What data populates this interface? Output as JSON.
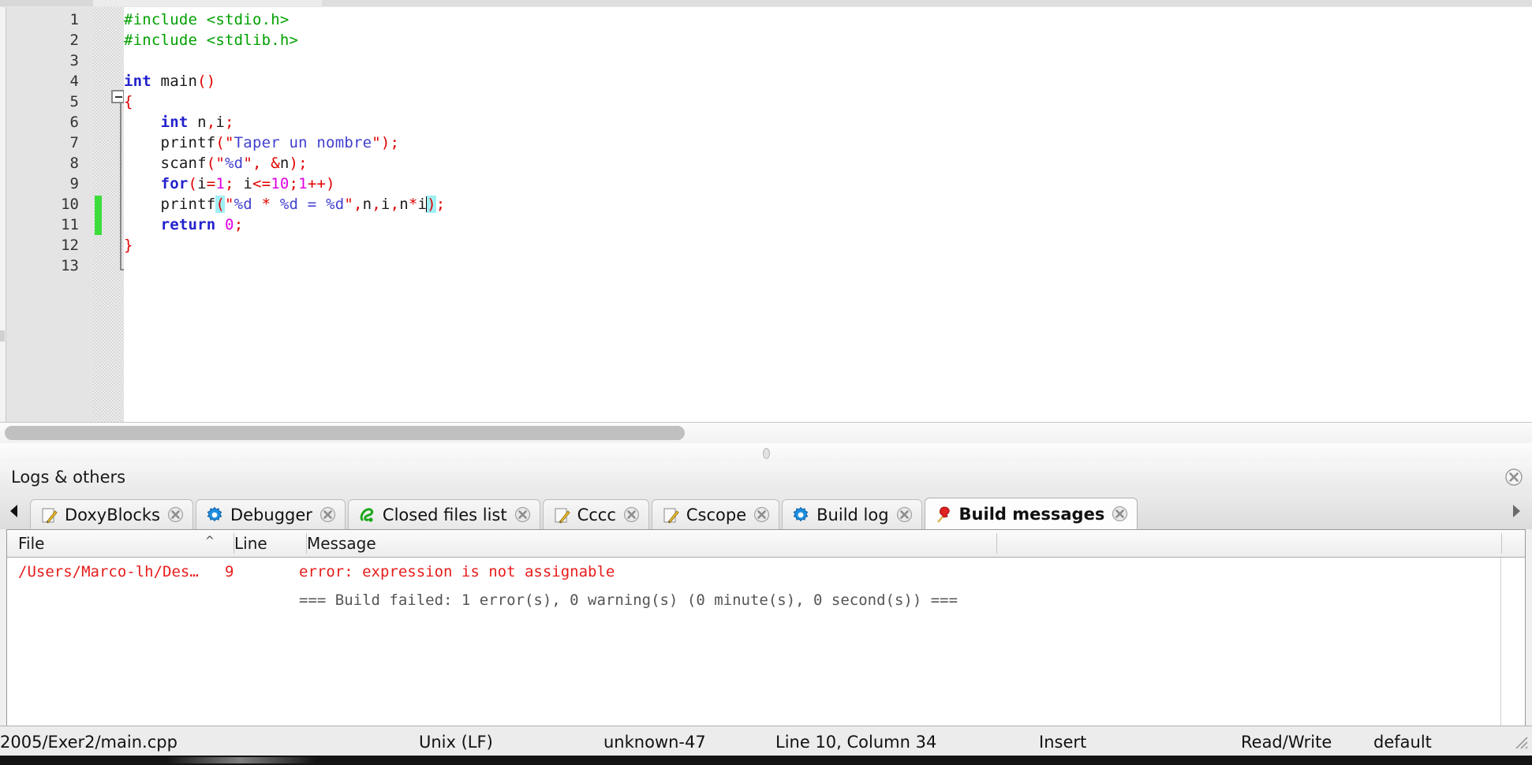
{
  "editor": {
    "line_numbers": [
      "1",
      "2",
      "3",
      "4",
      "5",
      "6",
      "7",
      "8",
      "9",
      "10",
      "11",
      "12",
      "13"
    ],
    "code_lines": [
      "#include <stdio.h>",
      "#include <stdlib.h>",
      "",
      "int main()",
      "{",
      "    int n,i;",
      "    printf(\"Taper un nombre\");",
      "    scanf(\"%d\", &n);",
      "    for(i=1; i<=10;1++)",
      "    printf(\"%d * %d = %d\",n,i,n*i);",
      "    return 0;",
      "}",
      ""
    ],
    "fold_marker_line": "5",
    "modified_lines": [
      "10",
      "11"
    ],
    "colors": {
      "preprocessor": "#00a000",
      "keyword": "#2222cc",
      "string": "#4040d0",
      "operator": "#e00000",
      "number": "#e000e0",
      "plain": "#1a1a1a",
      "brace_match_bg": "#9ff0f5",
      "change_bar": "#3cdc3c"
    }
  },
  "logs": {
    "title": "Logs & others",
    "close_icon": "close-circle-icon",
    "scroll_left_icon": "triangle-left-icon",
    "scroll_right_icon": "triangle-right-icon",
    "tabs": [
      {
        "label": "DoxyBlocks",
        "icon": "pencil-note-icon",
        "close_icon": "close-circle-icon",
        "active": false
      },
      {
        "label": "Debugger",
        "icon": "blue-gear-icon",
        "close_icon": "close-circle-icon",
        "active": false
      },
      {
        "label": "Closed files list",
        "icon": "green-plug-icon",
        "close_icon": "close-circle-icon",
        "active": false
      },
      {
        "label": "Cccc",
        "icon": "pencil-note-icon",
        "close_icon": "close-circle-icon",
        "active": false
      },
      {
        "label": "Cscope",
        "icon": "pencil-note-icon",
        "close_icon": "close-circle-icon",
        "active": false
      },
      {
        "label": "Build log",
        "icon": "blue-gear-icon",
        "close_icon": "close-circle-icon",
        "active": false
      },
      {
        "label": "Build messages",
        "icon": "red-pin-icon",
        "close_icon": "close-circle-icon",
        "active": true
      }
    ],
    "grid": {
      "columns": [
        "File",
        "Line",
        "Message",
        ""
      ],
      "sort_indicator": "^",
      "sorted_column": "File",
      "rows": [
        {
          "file": "/Users/Marco-lh/Des…",
          "line": "9",
          "message": "error: expression is not assignable",
          "style": "error"
        },
        {
          "file": "",
          "line": "",
          "message": "=== Build failed: 1 error(s), 0 warning(s) (0 minute(s), 0 second(s)) ===",
          "style": "summary"
        }
      ]
    }
  },
  "statusbar": {
    "file_path": "2005/Exer2/main.cpp",
    "line_ending": "Unix (LF)",
    "encoding": "unknown-47",
    "caret_position": "Line 10, Column 34",
    "insert_mode": "Insert",
    "access_mode": "Read/Write",
    "profile": "default",
    "resize_grip_icon": "resize-grip-icon"
  }
}
